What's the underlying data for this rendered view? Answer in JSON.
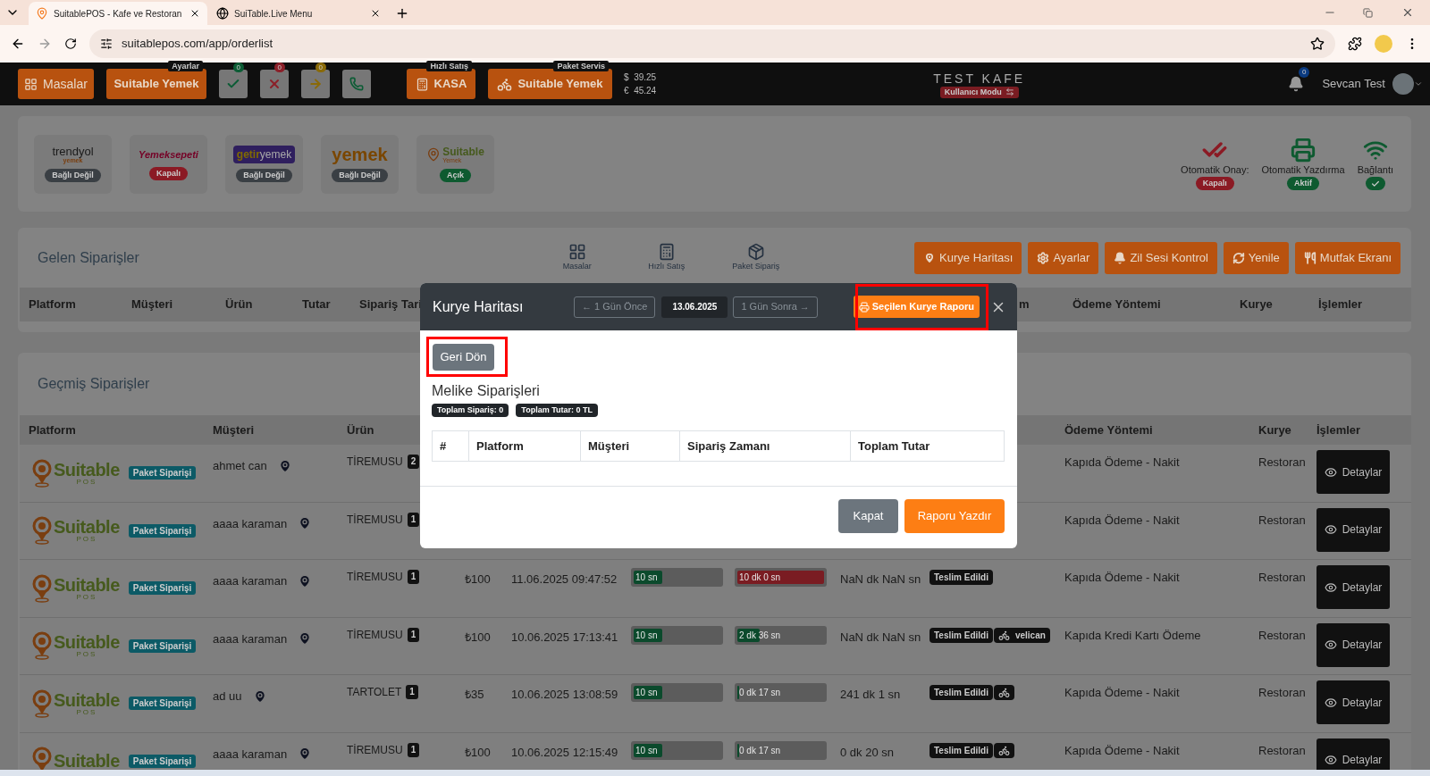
{
  "browser": {
    "tabs": [
      {
        "title": "SuitablePOS - Kafe ve Restoran",
        "selected": true
      },
      {
        "title": "SuiTable.Live Menu",
        "selected": false
      }
    ],
    "url": "suitablepos.com/app/orderlist"
  },
  "header": {
    "masalar": "Masalar",
    "yemek": {
      "label": "Suitable Yemek",
      "tag": "Ayarlar"
    },
    "counters": [
      {
        "kind": "accept",
        "count": "0",
        "color": "#0c5c35"
      },
      {
        "kind": "reject",
        "count": "0",
        "color": "#8b2029"
      },
      {
        "kind": "forward",
        "count": "0",
        "color": "#8a6a08"
      },
      {
        "kind": "call"
      }
    ],
    "kasa": {
      "label": "KASA",
      "tag": "Hızlı Satış"
    },
    "paket": {
      "label": "Suitable Yemek",
      "tag": "Paket Servis"
    },
    "rates": [
      {
        "symbol": "$",
        "value": "39.25"
      },
      {
        "symbol": "€",
        "value": "45.24"
      }
    ],
    "cafe": "TEST KAFE",
    "mode": "Kullanıcı Modu",
    "notifications": "0",
    "user": "Sevcan Test"
  },
  "platforms": [
    {
      "kind": "trendyol",
      "logo": "trendyol",
      "logo_sub": "yemek",
      "status": "Bağlı Değil",
      "color": "#3a3f44"
    },
    {
      "kind": "yemeksepeti",
      "logo": "Yemeksepeti",
      "status": "Kapalı",
      "color": "#8b1a24"
    },
    {
      "kind": "getir",
      "logo": "getir",
      "logo_sub": "yemek",
      "status": "Bağlı Değil",
      "color": "#3a3f44"
    },
    {
      "kind": "migros",
      "logo": "yemek",
      "status": "Bağlı Değil",
      "color": "#3a3f44"
    },
    {
      "kind": "suitable",
      "logo": "Suitable",
      "logo_sub": "Yemek",
      "status": "Açık",
      "color": "#0e5a30"
    }
  ],
  "settings": [
    {
      "kind": "approve",
      "label": "Otomatik Onay:",
      "status": "Kapalı",
      "color": "#8b1a24"
    },
    {
      "kind": "print",
      "label": "Otomatik Yazdırma",
      "status": "Aktif",
      "color": "#0e5a30"
    },
    {
      "kind": "connection",
      "label": "Bağlantı",
      "color": "#0e5a30"
    }
  ],
  "incoming": {
    "title": "Gelen Siparişler",
    "shortcuts": [
      {
        "kind": "tables",
        "label": "Masalar"
      },
      {
        "kind": "register",
        "label": "Hızlı Satış"
      },
      {
        "kind": "package",
        "label": "Paket Sipariş"
      }
    ],
    "actions": [
      {
        "kind": "map",
        "label": "Kurye Haritası"
      },
      {
        "kind": "settings",
        "label": "Ayarlar"
      },
      {
        "kind": "bell",
        "label": "Zil Sesi Kontrol"
      },
      {
        "kind": "refresh",
        "label": "Yenile"
      },
      {
        "kind": "kitchen",
        "label": "Mutfak Ekranı"
      }
    ],
    "columns": [
      "Platform",
      "Müşteri",
      "Ürün",
      "Tutar",
      "Sipariş Tari",
      "m",
      "Ödeme Yöntemi",
      "Kurye",
      "İşlemler"
    ]
  },
  "history": {
    "title": "Geçmiş Siparişler",
    "columns": [
      "Platform",
      "Müşteri",
      "Ürün",
      "Ödeme Yöntemi",
      "Kurye",
      "İşlemler"
    ],
    "rows": [
      {
        "logo": "Suitable",
        "logo_sub": "POS",
        "type": "Paket Siparişi",
        "customer": "ahmet can",
        "product": "TİREMUSU",
        "qty": "2",
        "payment": "Kapıda Ödeme - Nakit",
        "courier": "Restoran",
        "action": "Detaylar"
      },
      {
        "logo": "Suitable",
        "logo_sub": "POS",
        "type": "Paket Siparişi",
        "customer": "aaaa karaman",
        "product": "TİREMUSU",
        "qty": "1",
        "payment": "Kapıda Ödeme - Nakit",
        "courier": "Restoran",
        "action": "Detaylar"
      },
      {
        "logo": "Suitable",
        "logo_sub": "POS",
        "type": "Paket Siparişi",
        "customer": "aaaa karaman",
        "product": "TİREMUSU",
        "qty": "1",
        "amount": "₺100",
        "date": "11.06.2025 09:47:52",
        "prep": {
          "text": "10 sn",
          "level": 0.33
        },
        "delivery": {
          "text": "10 dk 0 sn",
          "level": 1,
          "color": "#7a1c22"
        },
        "duration": "NaN dk NaN sn",
        "status": "Teslim Edildi",
        "payment": "Kapıda Ödeme - Nakit",
        "courier": "Restoran",
        "action": "Detaylar"
      },
      {
        "logo": "Suitable",
        "logo_sub": "POS",
        "type": "Paket Siparişi",
        "customer": "aaaa karaman",
        "product": "TİREMUSU",
        "qty": "1",
        "amount": "₺100",
        "date": "10.06.2025 17:13:41",
        "prep": {
          "text": "10 sn",
          "level": 0.33
        },
        "delivery": {
          "text": "2 dk 36 sn",
          "level": 0.26,
          "color": "#0b4a2c"
        },
        "duration": "NaN dk NaN sn",
        "status": "Teslim Edildi",
        "rider": {
          "name": "velican"
        },
        "payment": "Kapıda Kredi Kartı Ödeme",
        "courier": "Restoran",
        "action": "Detaylar"
      },
      {
        "logo": "Suitable",
        "logo_sub": "POS",
        "type": "Paket Siparişi",
        "customer": "ad uu",
        "product": "TARTOLET",
        "qty": "1",
        "amount": "₺35",
        "date": "10.06.2025 13:08:59",
        "prep": {
          "text": "10 sn",
          "level": 0.33
        },
        "delivery": {
          "text": "0 dk 17 sn",
          "level": 0.02,
          "color": "#0b4a2c"
        },
        "duration": "241 dk 1 sn",
        "status": "Teslim Edildi",
        "rider": {},
        "payment": "Kapıda Ödeme - Nakit",
        "courier": "Restoran",
        "action": "Detaylar"
      },
      {
        "logo": "Suitable",
        "type": "Paket Siparişi",
        "customer": "aaaa karaman",
        "product": "TİREMUSU",
        "qty": "1",
        "amount": "₺100",
        "date": "10.06.2025 12:15:49",
        "prep": {
          "text": "10 sn",
          "level": 0.33
        },
        "delivery": {
          "text": "0 dk 17 sn",
          "level": 0.02,
          "color": "#0b4a2c"
        },
        "duration": "0 dk 20 sn",
        "status": "Teslim Edildi",
        "rider": {},
        "payment": "Kapıda Ödeme - Nakit",
        "courier": "Restoran",
        "action": "Detaylar"
      }
    ]
  },
  "modal": {
    "title": "Kurye Haritası",
    "prev": "← 1 Gün Önce",
    "date": "13.06.2025",
    "next": "1 Gün Sonra →",
    "report": {
      "label": "Seçilen Kurye Raporu",
      "highlighted": true
    },
    "back": {
      "label": "Geri Dön",
      "highlighted": true
    },
    "heading": "Melike Siparişleri",
    "badges": [
      "Toplam Sipariş: 0",
      "Toplam Tutar: 0 TL"
    ],
    "columns": [
      "#",
      "Platform",
      "Müşteri",
      "Sipariş Zamanı",
      "Toplam Tutar"
    ],
    "close": "Kapat",
    "print": "Raporu Yazdır"
  }
}
